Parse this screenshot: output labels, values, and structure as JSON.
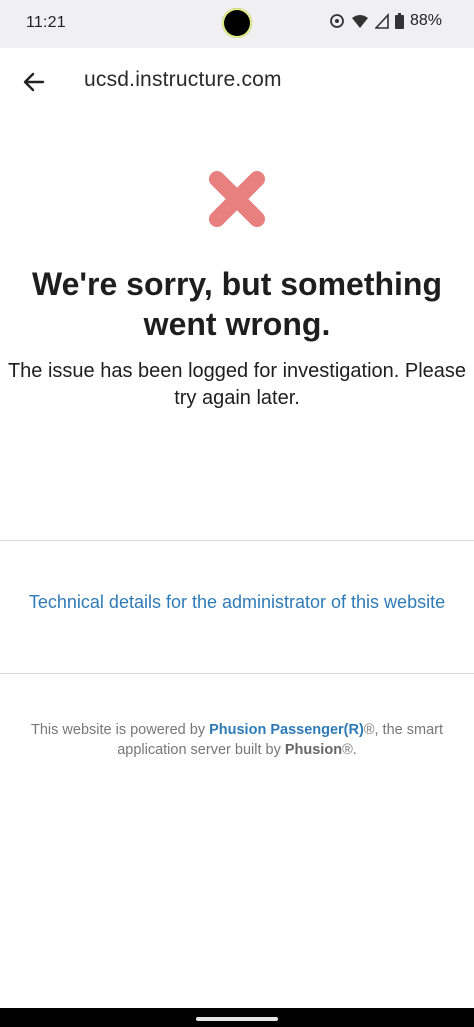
{
  "status_bar": {
    "time": "11:21",
    "battery": "88%",
    "icons": [
      "sync-icon",
      "wifi-icon",
      "signal-icon",
      "battery-icon"
    ]
  },
  "browser": {
    "url": "ucsd.instructure.com",
    "back_icon": "arrow-left-icon"
  },
  "error": {
    "icon": "x-mark-icon",
    "icon_color": "#e88080",
    "title": "We're sorry, but something went wrong.",
    "message": "The issue has been logged for investigation. Please try again later."
  },
  "details_link": "Technical details for the administrator of this website",
  "footer": {
    "prefix": "This website is powered by ",
    "brand": "Phusion Passenger(R)",
    "middle": "®, the smart application server built by ",
    "company": "Phusion",
    "suffix": "®."
  },
  "colors": {
    "link": "#2e7bb7",
    "title": "#1e1e1e",
    "footer_text": "#777777"
  }
}
